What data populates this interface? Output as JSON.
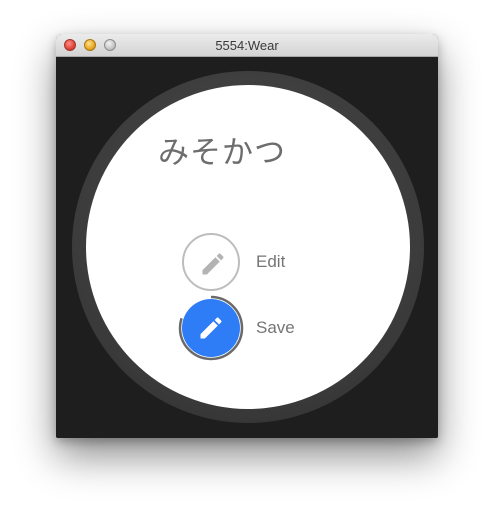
{
  "window": {
    "title": "5554:Wear"
  },
  "icons": {
    "close": "close-dot",
    "minimize": "minimize-dot",
    "zoom": "zoom-dot",
    "edit": "pencil-icon",
    "save": "pencil-icon"
  },
  "colors": {
    "save_button": "#2e7cf6",
    "edit_border": "#bdbdbd",
    "screen_bg": "#ffffff",
    "bezel": "#3a3a3a"
  },
  "screen": {
    "title": "みそかつ",
    "actions": [
      {
        "label": "Edit",
        "style": "outline"
      },
      {
        "label": "Save",
        "style": "filled",
        "progress": 0.8
      }
    ]
  }
}
